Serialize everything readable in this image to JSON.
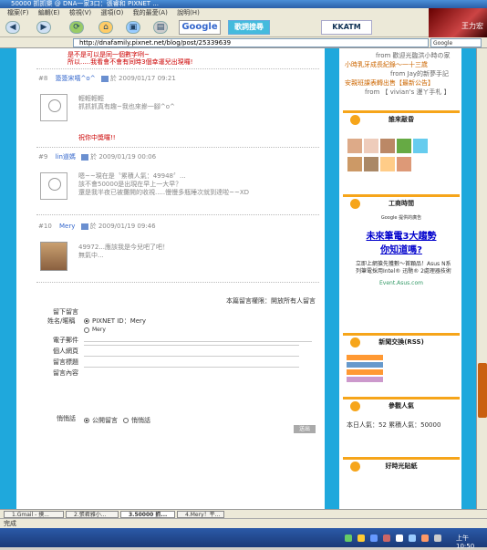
{
  "window": {
    "title": "50000 抓抓樂 @ DNA一家3口：張睿和 PIXNET ..."
  },
  "menu": [
    "檔案(F)",
    "編輯(E)",
    "檢視(V)",
    "選項(O)",
    "我的最愛(A)",
    "說明(H)"
  ],
  "toolbar": {
    "google": "Google",
    "search_btn": "歌詞搜尋",
    "kkatm": "KKATM"
  },
  "address": {
    "url": "http://dnafamily.pixnet.net/blog/post/25339639",
    "google_label": "Google"
  },
  "corner": {
    "label": "王力宏"
  },
  "comments": [
    {
      "pre1": "是不是可以是同一個數字咧~",
      "pre2": "所以.....我看會不會有同時3個幸運兒出現囉!"
    },
    {
      "num": "#8",
      "author": "簽簽宋嘻^o^",
      "date": "於 2009/01/17 09:21",
      "body1": "輕輕輕輕",
      "body2": "抓抓抓真有趣~我也來摻一腳^o^",
      "reply": "祝你中獎囉!!"
    },
    {
      "num": "#9",
      "author": "lin道媽",
      "date": "於 2009/01/19 00:06",
      "body1": "嗯~~現在是〝累積人氣：49948〞...",
      "body2": "該不會50000是出現在早上一大早？",
      "body3": "還是我半夜已被攤開的收視.....慢慢多瓶睡次就到達啦~~XD"
    },
    {
      "num": "#10",
      "author": "Mery",
      "date": "於 2009/01/19 09:46",
      "body1": "49972...應該我是今兒吧了吧！",
      "body2": "無氣中..."
    }
  ],
  "form": {
    "policy": "本篇留言權限：開放所有人留言",
    "title": "留下留言",
    "name_label": "姓名/暱稱",
    "pixnet_id": "PIXNET ID：Mery",
    "mery": "Mery",
    "email": "電子郵件",
    "site": "個人網頁",
    "subject": "留言標題",
    "content": "留言內容",
    "secret": "悄悄話",
    "public": "公開留言",
    "private": "悄悄話",
    "submit": "送出"
  },
  "sidebar": {
    "links": [
      "from 歡迎光臨洪小時の家",
      "小時乳牙成長紀錄～一十三歲",
      "from Jay的新夢手記",
      "安親班課表轉出售【最新公告】",
      "from 【 vivian's 漫ㄚ手札 】"
    ],
    "visitors_title": "誰來敲昏",
    "ad_title": "工商時間",
    "ad_provider": "Google 提供的廣告",
    "ad_headline1": "未來筆電3大趨勢",
    "ad_headline2": "你知道嗎?",
    "ad_body": "立即上網搶先獲數～首顆品！Asus N系列筆電採用Intel® 迅馳® 2處理器技術",
    "ad_link": "Event.Asus.com",
    "rss_title": "新聞交換(RSS)",
    "pop_title": "參觀人氣",
    "pop_text": "本日人氣：52 累積人氣：50000",
    "last_title": "好時光貼紙"
  },
  "tasks": [
    "1.Gmail - 摸...",
    "2.張君雅小...",
    "3.50000 抓...",
    "4.Mery！平..."
  ],
  "status": "完成",
  "clock": "上午 10:50"
}
